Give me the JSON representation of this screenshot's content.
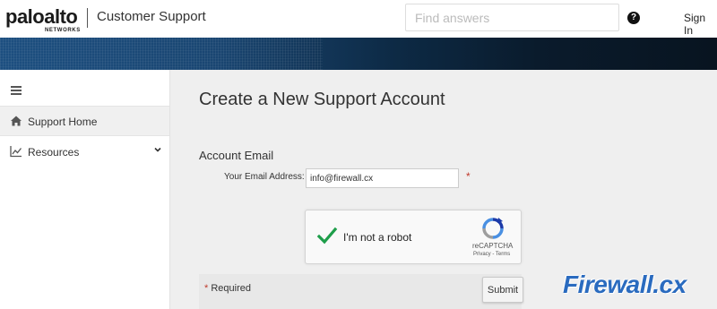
{
  "header": {
    "logo_word": "paloalto",
    "logo_sub": "NETWORKS",
    "app_title": "Customer Support",
    "search_placeholder": "Find answers",
    "help_icon": "question-circle-icon",
    "signin_label": "Sign In"
  },
  "sidebar": {
    "toggle_icon": "hamburger-menu-icon",
    "items": [
      {
        "label": "Support Home",
        "icon": "home-icon",
        "active": true
      },
      {
        "label": "Resources",
        "icon": "line-chart-icon",
        "expandable": true
      }
    ]
  },
  "main": {
    "page_title": "Create a New Support Account",
    "section_title": "Account Email",
    "email_label": "Your Email Address:",
    "email_value": "info@firewall.cx",
    "required_marker": "*",
    "captcha": {
      "label": "I'm not a robot",
      "checked": true,
      "brand": "reCAPTCHA",
      "links": "Privacy - Terms"
    },
    "required_note": "Required",
    "submit_label": "Submit"
  },
  "watermark": {
    "text": "Firewall.cx"
  },
  "colors": {
    "banner_start": "#1d4f80",
    "banner_end": "#081420",
    "check_green": "#1e9e4a",
    "required_red": "#c0392b",
    "watermark_blue": "#2a6bbf"
  }
}
